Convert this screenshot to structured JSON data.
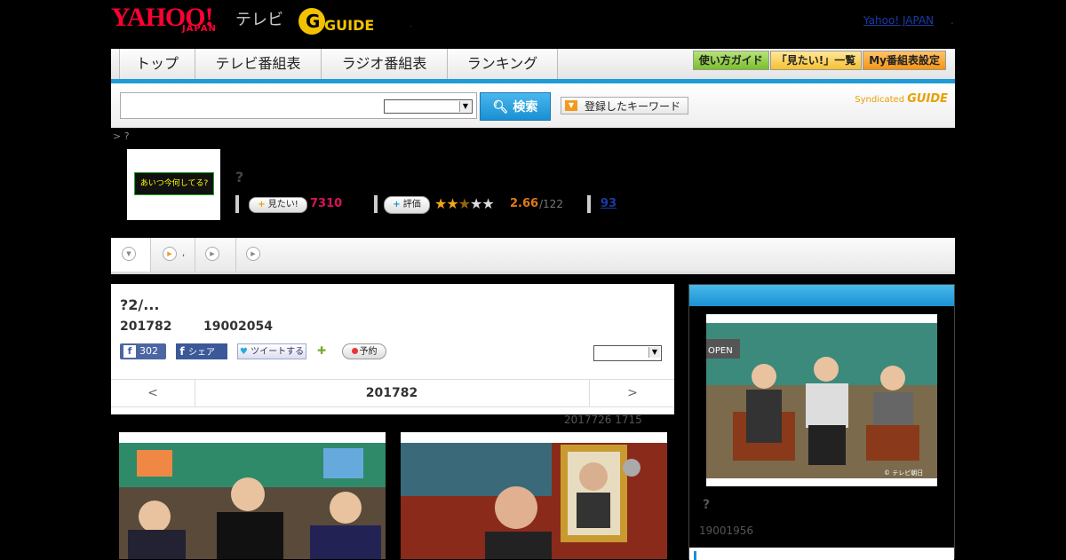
{
  "header": {
    "logo_yahoo": "YAHOO!",
    "logo_japan": "JAPAN",
    "logo_tv": "テレビ",
    "logo_gguide": "GUIDE",
    "logo_g": "G",
    "yahoo_japan_link": "Yahoo! JAPAN",
    "dot": "."
  },
  "nav": {
    "tabs": [
      "トップ",
      "テレビ番組表",
      "ラジオ番組表",
      "ランキング"
    ],
    "buttons": [
      "使い方ガイド",
      "「見たい!」一覧",
      "My番組表設定"
    ]
  },
  "search": {
    "button_label": "検索",
    "keyword_button": "登録したキーワード",
    "syndicated_text": "Syndicated",
    "syndicated_logo": "GUIDE"
  },
  "breadcrumb": "> ?",
  "program": {
    "thumb_text": "あいつ今何してる?",
    "title": "?",
    "mitai_label": "見たい!",
    "mitai_count": "7310",
    "hyoka_label": "評価",
    "rating": "2.66",
    "rating_total": "/122",
    "comments": "93",
    "stars_filled": 2.66,
    "stars_max": 5
  },
  "subtabs": {
    "tab2_suffix": ","
  },
  "episode": {
    "title": "?2/...",
    "date": "201782",
    "number": "19002054",
    "fb_like_count": "302",
    "fb_share": "シェア",
    "tweet": "ツイートする",
    "yoyaku": "予約",
    "nav_prev": "<",
    "nav_date": "201782",
    "nav_next": ">",
    "updated": "2017726  1715"
  },
  "right_panel": {
    "title": "?",
    "number": "19001956",
    "photo_credit": "© テレビ朝日"
  },
  "colors": {
    "accent_blue": "#1f9bd7",
    "brand_red": "#ff0033",
    "mitai_pink": "#d6145c",
    "rating_orange": "#e07a18"
  }
}
